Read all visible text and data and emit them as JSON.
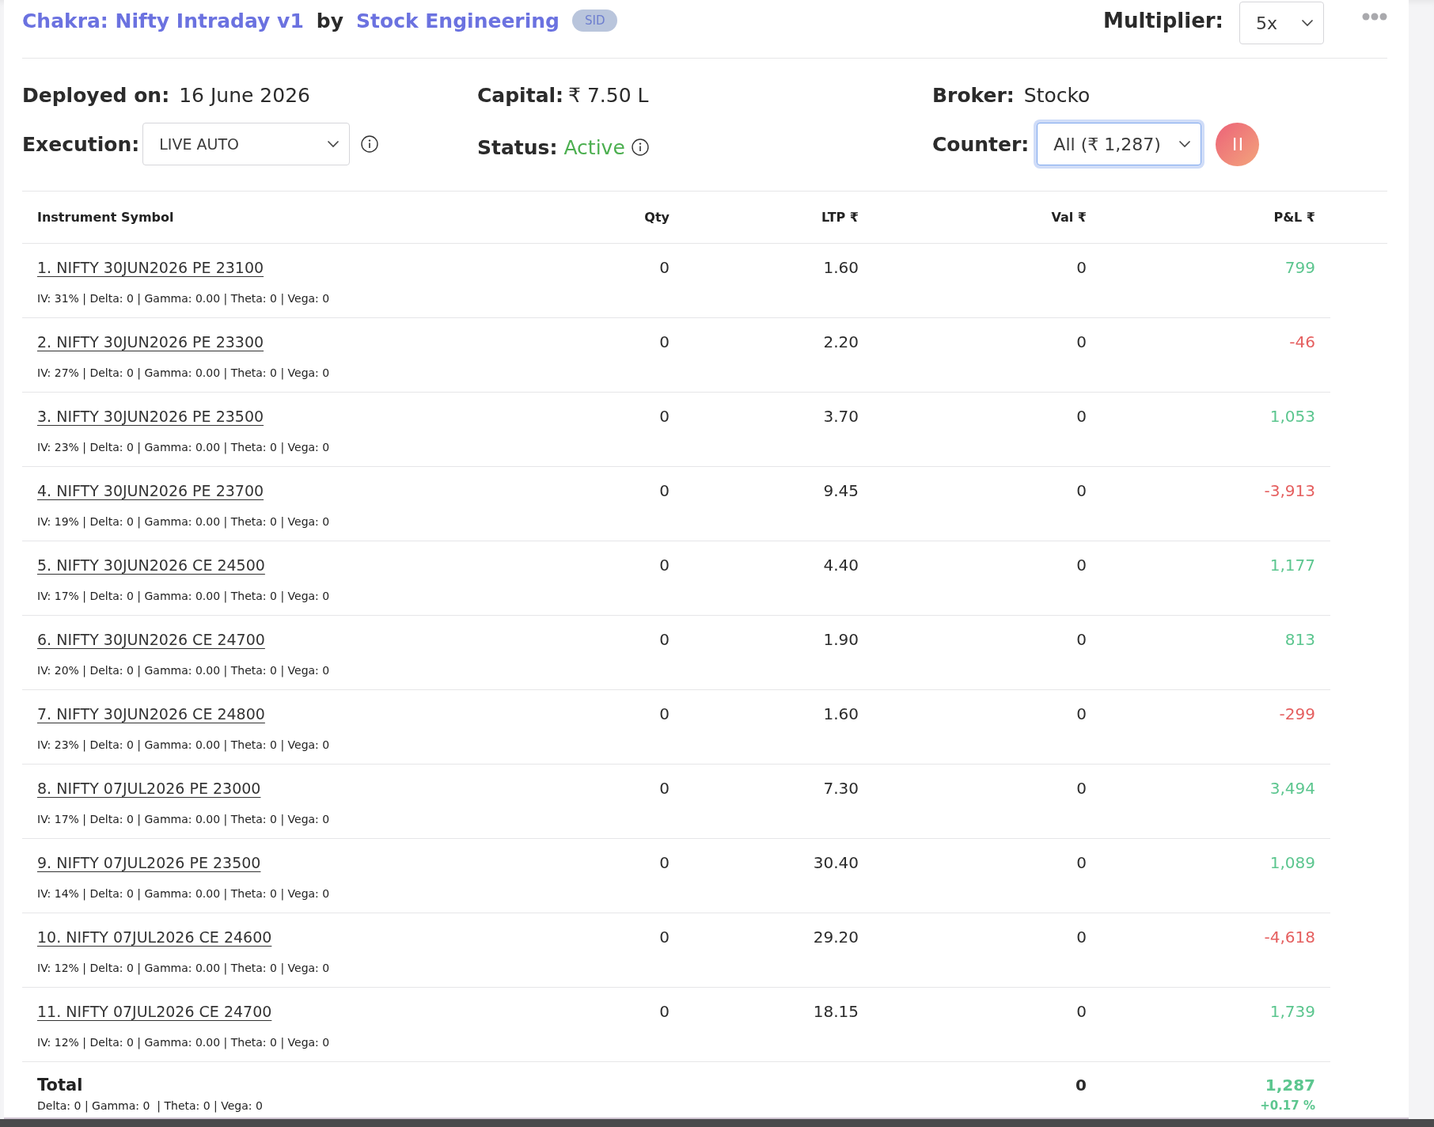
{
  "header": {
    "title": "Chakra: Nifty Intraday v1",
    "by": "by",
    "author": "Stock Engineering",
    "badge": "SID",
    "multiplier": {
      "label": "Multiplier:",
      "value": "5x"
    }
  },
  "details": {
    "deployed_on": {
      "label": "Deployed on:",
      "value": "16 June 2026"
    },
    "capital": {
      "label": "Capital:",
      "value": "₹ 7.50 L"
    },
    "broker": {
      "label": "Broker:",
      "value": "Stocko"
    },
    "execution": {
      "label": "Execution:",
      "value": "LIVE AUTO"
    },
    "status": {
      "label": "Status:",
      "value": "Active",
      "active": true
    },
    "counter": {
      "label": "Counter:",
      "value": "All (₹ 1,287)",
      "focused": true
    }
  },
  "table": {
    "columns": [
      "Instrument Symbol",
      "Qty",
      "LTP ₹",
      "Val ₹",
      "P&L ₹"
    ],
    "rows": [
      {
        "symbol": "1. NIFTY 30JUN2026 PE 23100",
        "greeks": "IV: 31% | Delta: 0 | Gamma: 0.00 | Theta: 0 | Vega: 0",
        "qty": "0",
        "ltp": "1.60",
        "val": "0",
        "pnl": "799",
        "profit": true
      },
      {
        "symbol": "2. NIFTY 30JUN2026 PE 23300",
        "greeks": "IV: 27% | Delta: 0 | Gamma: 0.00 | Theta: 0 | Vega: 0",
        "qty": "0",
        "ltp": "2.20",
        "val": "0",
        "pnl": "-46",
        "profit": false
      },
      {
        "symbol": "3. NIFTY 30JUN2026 PE 23500",
        "greeks": "IV: 23% | Delta: 0 | Gamma: 0.00 | Theta: 0 | Vega: 0",
        "qty": "0",
        "ltp": "3.70",
        "val": "0",
        "pnl": "1,053",
        "profit": true
      },
      {
        "symbol": "4. NIFTY 30JUN2026 PE 23700",
        "greeks": "IV: 19% | Delta: 0 | Gamma: 0.00 | Theta: 0 | Vega: 0",
        "qty": "0",
        "ltp": "9.45",
        "val": "0",
        "pnl": "-3,913",
        "profit": false
      },
      {
        "symbol": "5. NIFTY 30JUN2026 CE 24500",
        "greeks": "IV: 17% | Delta: 0 | Gamma: 0.00 | Theta: 0 | Vega: 0",
        "qty": "0",
        "ltp": "4.40",
        "val": "0",
        "pnl": "1,177",
        "profit": true
      },
      {
        "symbol": "6. NIFTY 30JUN2026 CE 24700",
        "greeks": "IV: 20% | Delta: 0 | Gamma: 0.00 | Theta: 0 | Vega: 0",
        "qty": "0",
        "ltp": "1.90",
        "val": "0",
        "pnl": "813",
        "profit": true
      },
      {
        "symbol": "7. NIFTY 30JUN2026 CE 24800",
        "greeks": "IV: 23% | Delta: 0 | Gamma: 0.00 | Theta: 0 | Vega: 0",
        "qty": "0",
        "ltp": "1.60",
        "val": "0",
        "pnl": "-299",
        "profit": false
      },
      {
        "symbol": "8. NIFTY 07JUL2026 PE 23000",
        "greeks": "IV: 17% | Delta: 0 | Gamma: 0.00 | Theta: 0 | Vega: 0",
        "qty": "0",
        "ltp": "7.30",
        "val": "0",
        "pnl": "3,494",
        "profit": true
      },
      {
        "symbol": "9. NIFTY 07JUL2026 PE 23500",
        "greeks": "IV: 14% | Delta: 0 | Gamma: 0.00 | Theta: 0 | Vega: 0",
        "qty": "0",
        "ltp": "30.40",
        "val": "0",
        "pnl": "1,089",
        "profit": true
      },
      {
        "symbol": "10. NIFTY 07JUL2026 CE 24600",
        "greeks": "IV: 12% | Delta: 0 | Gamma: 0.00 | Theta: 0 | Vega: 0",
        "qty": "0",
        "ltp": "29.20",
        "val": "0",
        "pnl": "-4,618",
        "profit": false
      },
      {
        "symbol": "11. NIFTY 07JUL2026 CE 24700",
        "greeks": "IV: 12% | Delta: 0 | Gamma: 0.00 | Theta: 0 | Vega: 0",
        "qty": "0",
        "ltp": "18.15",
        "val": "0",
        "pnl": "1,739",
        "profit": true
      }
    ],
    "total": {
      "label": "Total",
      "greeks": "Delta: 0 | Gamma: 0  | Theta: 0 | Vega: 0",
      "val": "0",
      "pnl": "1,287",
      "pnl_percent": "+0.17 %",
      "profit": true
    }
  }
}
